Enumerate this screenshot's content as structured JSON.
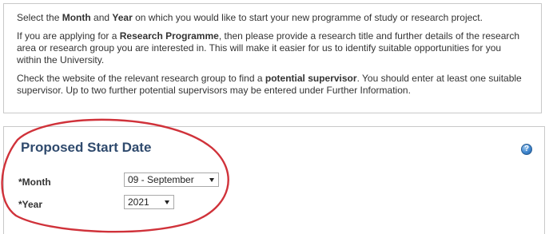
{
  "info": {
    "para1_a": "Select the ",
    "para1_month": "Month",
    "para1_and": " and ",
    "para1_year": "Year",
    "para1_b": " on which you would like to start your new programme of study or research project.",
    "para2_a": "If you are applying for a ",
    "para2_bold": "Research Programme",
    "para2_b": ", then please provide a research title and further details of the research area or research group you are interested in. This will make it easier for us to identify suitable opportunities for you within the University.",
    "para3_a": "Check the website of the relevant research group to find a ",
    "para3_bold": "potential supervisor",
    "para3_b": ". You should enter at least one suitable supervisor. Up to two further potential supervisors may be entered under Further Information."
  },
  "start_date": {
    "title": "Proposed Start Date",
    "help_symbol": "?",
    "month_label": "*Month",
    "month_value": "09 - September",
    "year_label": "*Year",
    "year_value": "2021"
  },
  "colors": {
    "title": "#2f4a6d",
    "annotation": "#d0323a",
    "border": "#c9c9c9"
  },
  "icons": {
    "help": "help-icon",
    "dropdown": "chevron-down-icon"
  }
}
